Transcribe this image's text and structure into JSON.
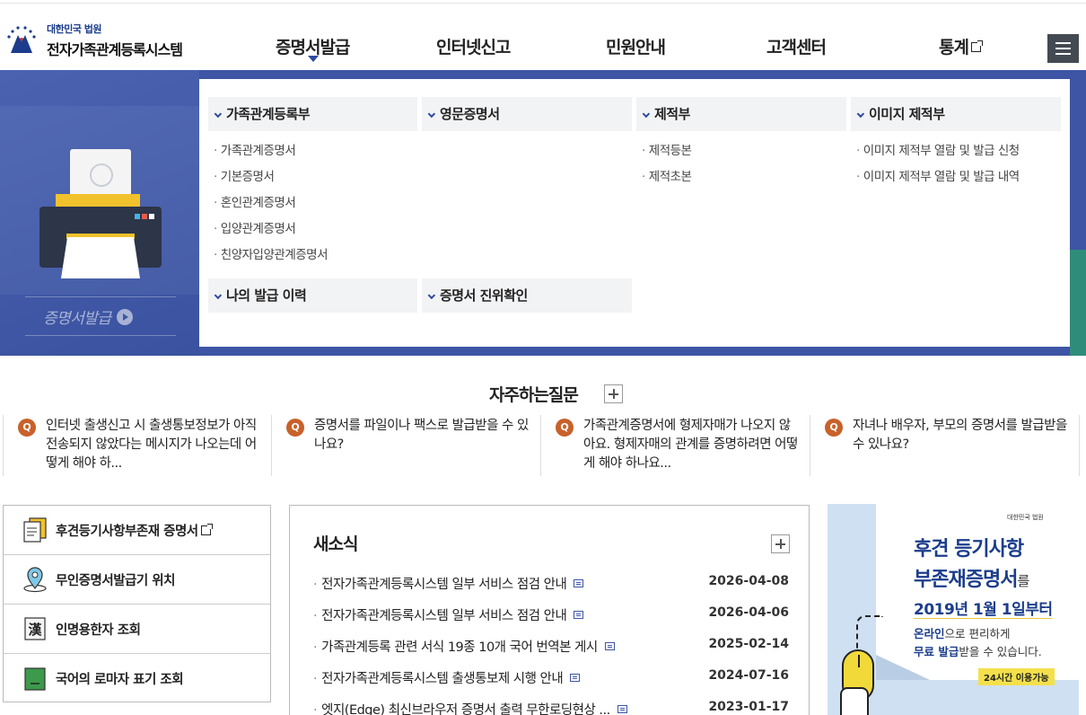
{
  "header": {
    "logo_sub": "대한민국 법원",
    "logo_main": "전자가족관계등록시스템",
    "nav": [
      {
        "label": "증명서발급"
      },
      {
        "label": "인터넷신고"
      },
      {
        "label": "민원안내"
      },
      {
        "label": "고객센터"
      },
      {
        "label": "통계"
      }
    ]
  },
  "mega": {
    "side_title": "증명서발급",
    "categories": [
      {
        "label": "가족관계등록부",
        "items": [
          "가족관계증명서",
          "기본증명서",
          "혼인관계증명서",
          "입양관계증명서",
          "친양자입양관계증명서"
        ]
      },
      {
        "label": "영문증명서",
        "items": []
      },
      {
        "label": "제적부",
        "items": [
          "제적등본",
          "제적초본"
        ]
      },
      {
        "label": "이미지 제적부",
        "items": [
          "이미지 제적부 열람 및 발급 신청",
          "이미지 제적부 열람 및 발급 내역"
        ]
      },
      {
        "label": "나의 발급 이력",
        "items": []
      },
      {
        "label": "증명서 진위확인",
        "items": []
      }
    ]
  },
  "faq": {
    "title": "자주하는질문",
    "badge": "Q",
    "items": [
      "인터넷 출생신고 시 출생통보정보가 아직 전송되지 않았다는 메시지가 나오는데 어떻게 해야 하...",
      "증명서를 파일이나 팩스로 발급받을 수 있나요?",
      "가족관계증명서에 형제자매가 나오지 않아요. 형제자매의 관계를 증명하려면 어떻게 해야 하나요...",
      "자녀나 배우자, 부모의 증명서를 발급받을 수 있나요?"
    ]
  },
  "quick_links": [
    {
      "label": "후견등기사항부존재 증명서"
    },
    {
      "label": "무인증명서발급기 위치"
    },
    {
      "label": "인명용한자 조회"
    },
    {
      "label": "국어의 로마자 표기 조회"
    }
  ],
  "quick_icon_text": {
    "hanja": "漢"
  },
  "news": {
    "title": "새소식",
    "items": [
      {
        "title": "전자가족관계등록시스템 일부 서비스 점검 안내",
        "date": "2026-04-08"
      },
      {
        "title": "전자가족관계등록시스템 일부 서비스 점검 안내",
        "date": "2026-04-06"
      },
      {
        "title": "가족관계등록 관련 서식 19종 10개 국어 번역본 게시",
        "date": "2025-02-14"
      },
      {
        "title": "전자가족관계등록시스템 출생통보제 시행 안내",
        "date": "2024-07-16"
      },
      {
        "title": "엣지(Edge) 최신브라우저 증명서 출력 무한로딩현상 ...",
        "date": "2023-01-17"
      }
    ]
  },
  "banner": {
    "logo": "대한민국 법원",
    "line1": "후견 등기사항",
    "line2": "부존재증명서",
    "line2_suffix": "를",
    "line3": "2019년 1월 1일부터",
    "line4_bold": "온라인",
    "line4_rest": "으로 편리하게",
    "line5_bold": "무료 발급",
    "line5_rest": "받을 수 있습니다.",
    "badge": "24시간 이용가능"
  },
  "colors": {
    "brand": "#3d55a4",
    "faq_badge": "#c8612a",
    "accent_yellow": "#f2c22c"
  }
}
